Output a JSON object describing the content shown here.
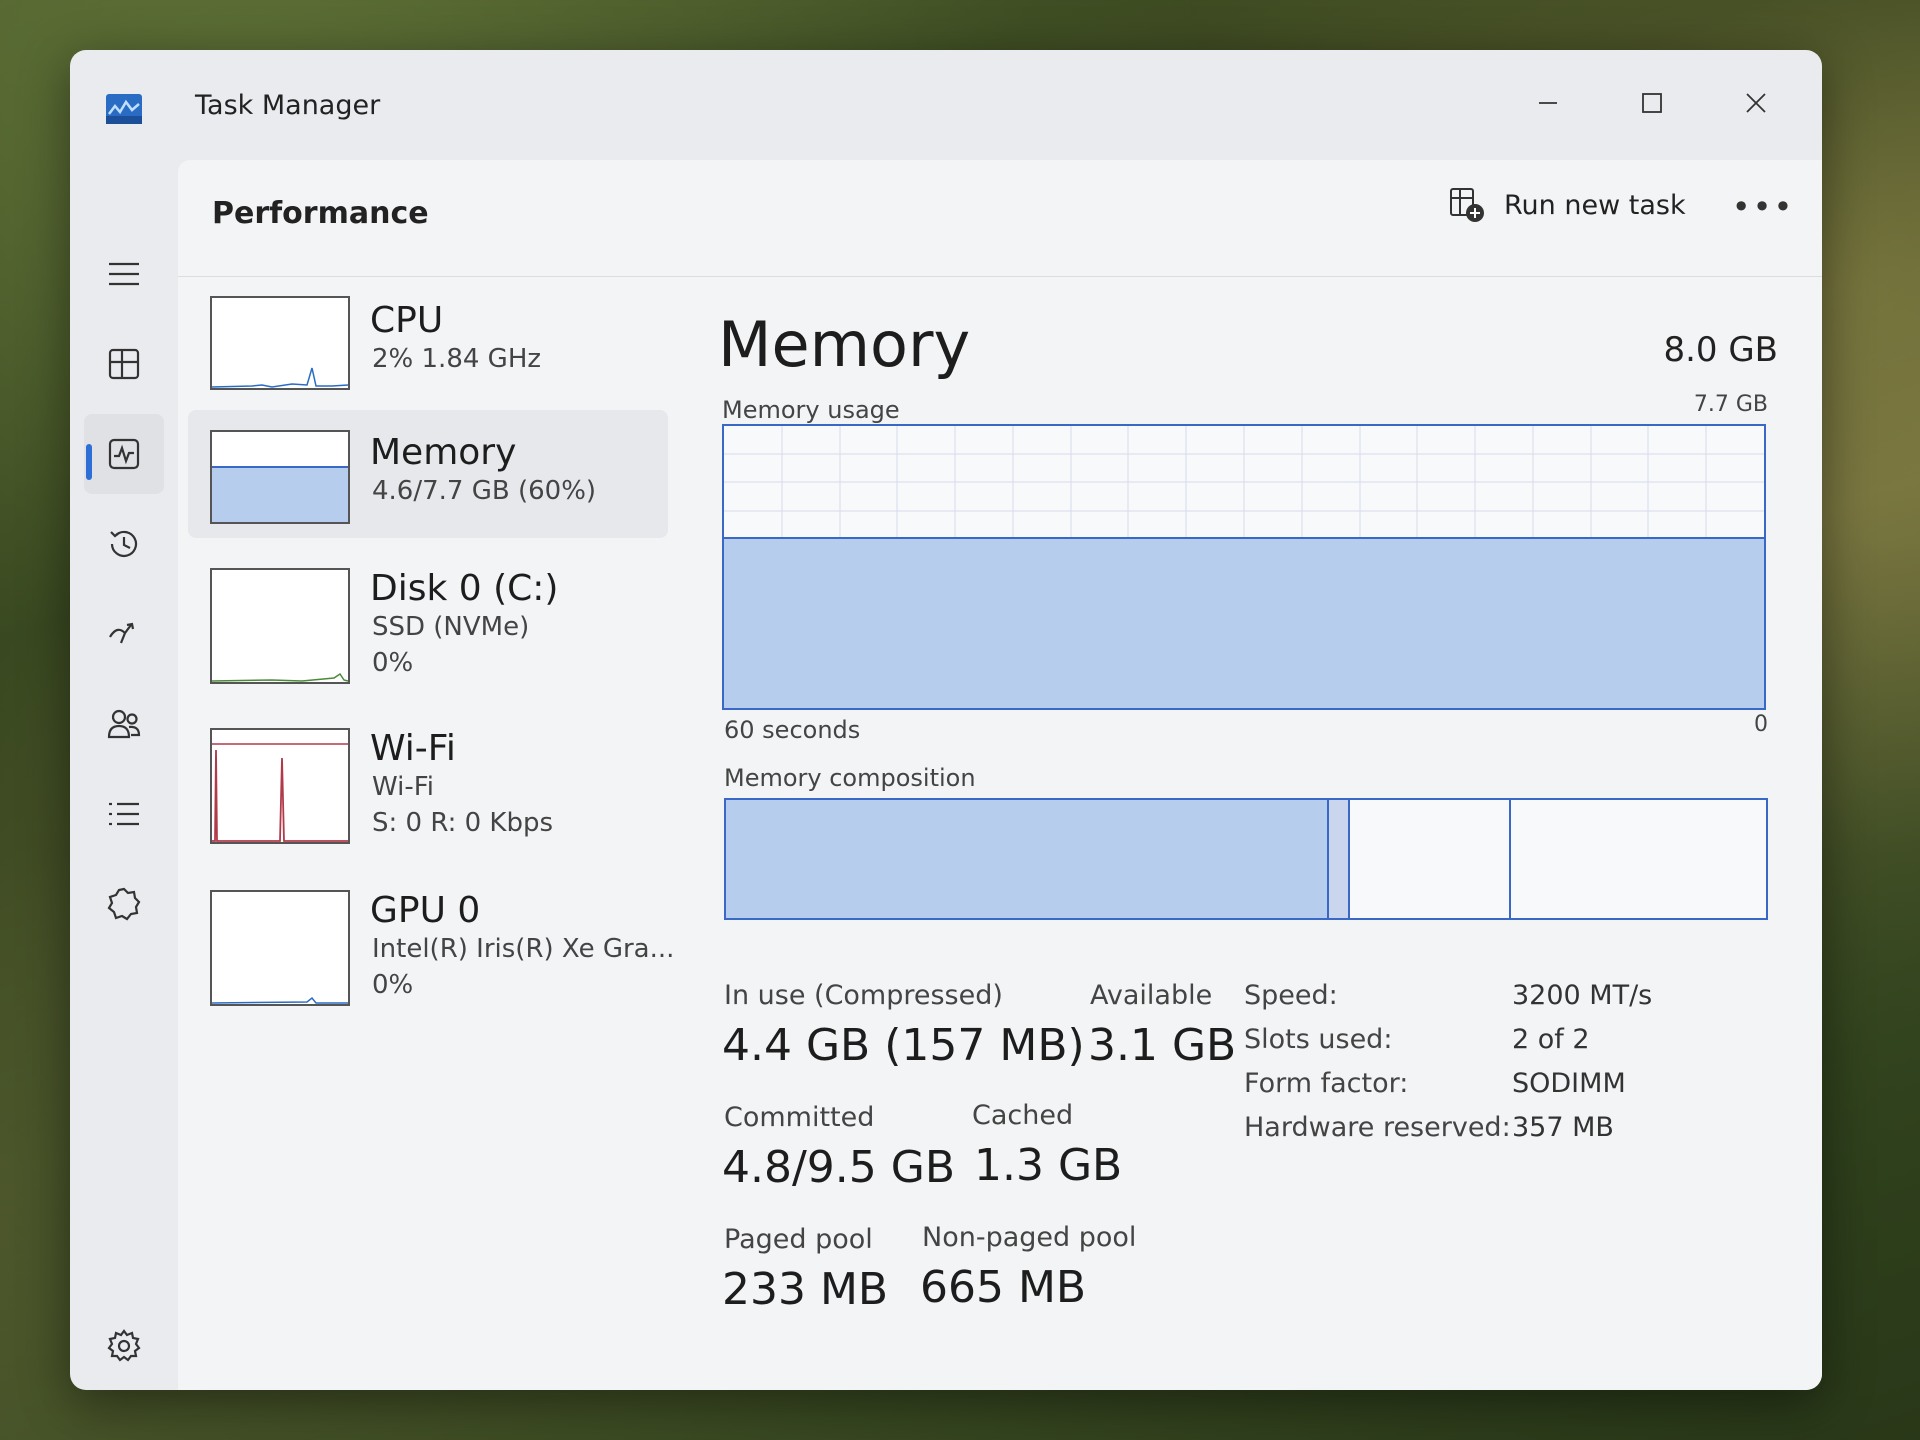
{
  "window": {
    "title": "Task Manager"
  },
  "header": {
    "title": "Performance",
    "run_new_task": "Run new task",
    "more": "•••"
  },
  "sidebar": {
    "items": [
      {
        "name": "hamburger-menu-icon"
      },
      {
        "name": "processes-icon"
      },
      {
        "name": "performance-icon",
        "active": true
      },
      {
        "name": "app-history-icon"
      },
      {
        "name": "startup-apps-icon"
      },
      {
        "name": "users-icon"
      },
      {
        "name": "details-icon"
      },
      {
        "name": "services-icon"
      },
      {
        "name": "settings-icon"
      }
    ]
  },
  "devices": [
    {
      "name": "CPU",
      "sub1": "2% 1.84 GHz"
    },
    {
      "name": "Memory",
      "sub1": "4.6/7.7 GB (60%)",
      "active": true,
      "fill": 0.6
    },
    {
      "name": "Disk 0 (C:)",
      "sub1": "SSD (NVMe)",
      "sub2": "0%"
    },
    {
      "name": "Wi-Fi",
      "sub1": "Wi-Fi",
      "sub2": "S: 0 R: 0 Kbps"
    },
    {
      "name": "GPU 0",
      "sub1": "Intel(R) Iris(R) Xe Gra...",
      "sub2": "0%"
    }
  ],
  "memory": {
    "title": "Memory",
    "total": "8.0 GB",
    "usage_label": "Memory usage",
    "usage_max": "7.7 GB",
    "usage_fraction": 0.6,
    "time_label": "60 seconds",
    "zero_label": "0",
    "composition_label": "Memory composition",
    "composition": [
      {
        "name": "in-use",
        "fraction": 0.58
      },
      {
        "name": "modified",
        "fraction": 0.02
      },
      {
        "name": "standby",
        "fraction": 0.155
      },
      {
        "name": "free",
        "fraction": 0.245
      }
    ],
    "stats": {
      "in_use_label": "In use (Compressed)",
      "in_use_value": "4.4 GB (157 MB)",
      "available_label": "Available",
      "available_value": "3.1 GB",
      "committed_label": "Committed",
      "committed_value": "4.8/9.5 GB",
      "cached_label": "Cached",
      "cached_value": "1.3 GB",
      "paged_label": "Paged pool",
      "paged_value": "233 MB",
      "nonpaged_label": "Non-paged pool",
      "nonpaged_value": "665 MB"
    },
    "specs": {
      "speed_key": "Speed:",
      "speed_val": "3200 MT/s",
      "slots_key": "Slots used:",
      "slots_val": "2 of 2",
      "form_key": "Form factor:",
      "form_val": "SODIMM",
      "hw_key": "Hardware reserved:",
      "hw_val": "357 MB"
    }
  },
  "colors": {
    "accent": "#2d6fd6",
    "memory_fill": "#b7cdee",
    "memory_border": "#3a68c6",
    "wifi_line": "#b03a4a"
  }
}
